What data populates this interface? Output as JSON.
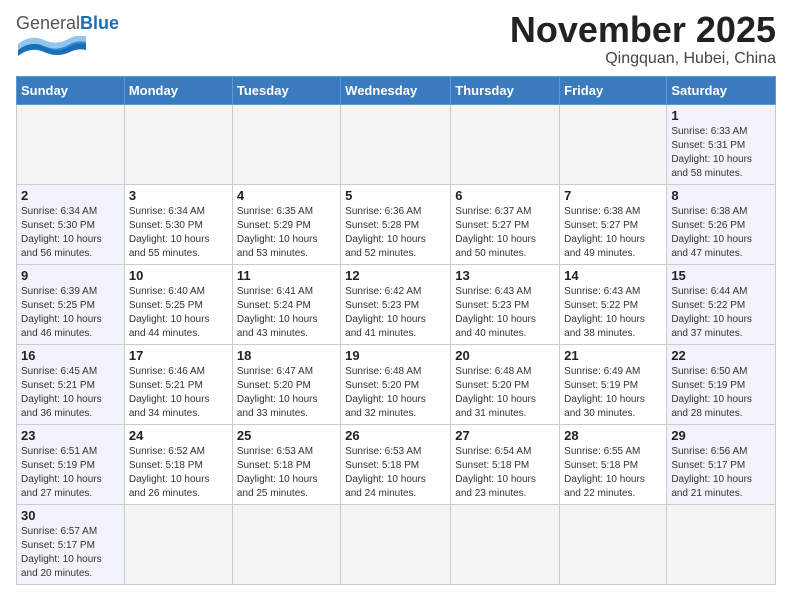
{
  "header": {
    "logo_general": "General",
    "logo_blue": "Blue",
    "month_title": "November 2025",
    "location": "Qingquan, Hubei, China"
  },
  "days_of_week": [
    "Sunday",
    "Monday",
    "Tuesday",
    "Wednesday",
    "Thursday",
    "Friday",
    "Saturday"
  ],
  "weeks": [
    [
      {
        "day": "",
        "info": ""
      },
      {
        "day": "",
        "info": ""
      },
      {
        "day": "",
        "info": ""
      },
      {
        "day": "",
        "info": ""
      },
      {
        "day": "",
        "info": ""
      },
      {
        "day": "",
        "info": ""
      },
      {
        "day": "1",
        "info": "Sunrise: 6:33 AM\nSunset: 5:31 PM\nDaylight: 10 hours\nand 58 minutes."
      }
    ],
    [
      {
        "day": "2",
        "info": "Sunrise: 6:34 AM\nSunset: 5:30 PM\nDaylight: 10 hours\nand 56 minutes."
      },
      {
        "day": "3",
        "info": "Sunrise: 6:34 AM\nSunset: 5:30 PM\nDaylight: 10 hours\nand 55 minutes."
      },
      {
        "day": "4",
        "info": "Sunrise: 6:35 AM\nSunset: 5:29 PM\nDaylight: 10 hours\nand 53 minutes."
      },
      {
        "day": "5",
        "info": "Sunrise: 6:36 AM\nSunset: 5:28 PM\nDaylight: 10 hours\nand 52 minutes."
      },
      {
        "day": "6",
        "info": "Sunrise: 6:37 AM\nSunset: 5:27 PM\nDaylight: 10 hours\nand 50 minutes."
      },
      {
        "day": "7",
        "info": "Sunrise: 6:38 AM\nSunset: 5:27 PM\nDaylight: 10 hours\nand 49 minutes."
      },
      {
        "day": "8",
        "info": "Sunrise: 6:38 AM\nSunset: 5:26 PM\nDaylight: 10 hours\nand 47 minutes."
      }
    ],
    [
      {
        "day": "9",
        "info": "Sunrise: 6:39 AM\nSunset: 5:25 PM\nDaylight: 10 hours\nand 46 minutes."
      },
      {
        "day": "10",
        "info": "Sunrise: 6:40 AM\nSunset: 5:25 PM\nDaylight: 10 hours\nand 44 minutes."
      },
      {
        "day": "11",
        "info": "Sunrise: 6:41 AM\nSunset: 5:24 PM\nDaylight: 10 hours\nand 43 minutes."
      },
      {
        "day": "12",
        "info": "Sunrise: 6:42 AM\nSunset: 5:23 PM\nDaylight: 10 hours\nand 41 minutes."
      },
      {
        "day": "13",
        "info": "Sunrise: 6:43 AM\nSunset: 5:23 PM\nDaylight: 10 hours\nand 40 minutes."
      },
      {
        "day": "14",
        "info": "Sunrise: 6:43 AM\nSunset: 5:22 PM\nDaylight: 10 hours\nand 38 minutes."
      },
      {
        "day": "15",
        "info": "Sunrise: 6:44 AM\nSunset: 5:22 PM\nDaylight: 10 hours\nand 37 minutes."
      }
    ],
    [
      {
        "day": "16",
        "info": "Sunrise: 6:45 AM\nSunset: 5:21 PM\nDaylight: 10 hours\nand 36 minutes."
      },
      {
        "day": "17",
        "info": "Sunrise: 6:46 AM\nSunset: 5:21 PM\nDaylight: 10 hours\nand 34 minutes."
      },
      {
        "day": "18",
        "info": "Sunrise: 6:47 AM\nSunset: 5:20 PM\nDaylight: 10 hours\nand 33 minutes."
      },
      {
        "day": "19",
        "info": "Sunrise: 6:48 AM\nSunset: 5:20 PM\nDaylight: 10 hours\nand 32 minutes."
      },
      {
        "day": "20",
        "info": "Sunrise: 6:48 AM\nSunset: 5:20 PM\nDaylight: 10 hours\nand 31 minutes."
      },
      {
        "day": "21",
        "info": "Sunrise: 6:49 AM\nSunset: 5:19 PM\nDaylight: 10 hours\nand 30 minutes."
      },
      {
        "day": "22",
        "info": "Sunrise: 6:50 AM\nSunset: 5:19 PM\nDaylight: 10 hours\nand 28 minutes."
      }
    ],
    [
      {
        "day": "23",
        "info": "Sunrise: 6:51 AM\nSunset: 5:19 PM\nDaylight: 10 hours\nand 27 minutes."
      },
      {
        "day": "24",
        "info": "Sunrise: 6:52 AM\nSunset: 5:18 PM\nDaylight: 10 hours\nand 26 minutes."
      },
      {
        "day": "25",
        "info": "Sunrise: 6:53 AM\nSunset: 5:18 PM\nDaylight: 10 hours\nand 25 minutes."
      },
      {
        "day": "26",
        "info": "Sunrise: 6:53 AM\nSunset: 5:18 PM\nDaylight: 10 hours\nand 24 minutes."
      },
      {
        "day": "27",
        "info": "Sunrise: 6:54 AM\nSunset: 5:18 PM\nDaylight: 10 hours\nand 23 minutes."
      },
      {
        "day": "28",
        "info": "Sunrise: 6:55 AM\nSunset: 5:18 PM\nDaylight: 10 hours\nand 22 minutes."
      },
      {
        "day": "29",
        "info": "Sunrise: 6:56 AM\nSunset: 5:17 PM\nDaylight: 10 hours\nand 21 minutes."
      }
    ],
    [
      {
        "day": "30",
        "info": "Sunrise: 6:57 AM\nSunset: 5:17 PM\nDaylight: 10 hours\nand 20 minutes."
      },
      {
        "day": "",
        "info": ""
      },
      {
        "day": "",
        "info": ""
      },
      {
        "day": "",
        "info": ""
      },
      {
        "day": "",
        "info": ""
      },
      {
        "day": "",
        "info": ""
      },
      {
        "day": "",
        "info": ""
      }
    ]
  ]
}
